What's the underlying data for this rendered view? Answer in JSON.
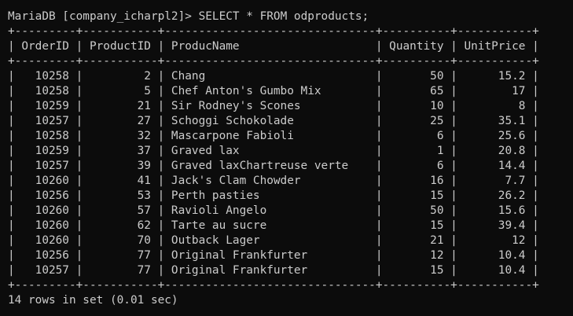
{
  "prompt": "MariaDB [company_icharpl2]>",
  "command": "SELECT * FROM odproducts;",
  "table": {
    "border": "+---------+-----------+-------------------------------+----------+-----------+",
    "header": "| OrderID | ProductID | ProducName                    | Quantity | UnitPrice |",
    "rows": [
      "|   10258 |         2 | Chang                         |       50 |      15.2 |",
      "|   10258 |         5 | Chef Anton's Gumbo Mix        |       65 |        17 |",
      "|   10259 |        21 | Sir Rodney's Scones           |       10 |         8 |",
      "|   10257 |        27 | Schoggi Schokolade            |       25 |      35.1 |",
      "|   10258 |        32 | Mascarpone Fabioli            |        6 |      25.6 |",
      "|   10259 |        37 | Graved lax                    |        1 |      20.8 |",
      "|   10257 |        39 | Graved laxChartreuse verte    |        6 |      14.4 |",
      "|   10260 |        41 | Jack's Clam Chowder           |       16 |       7.7 |",
      "|   10256 |        53 | Perth pasties                 |       15 |      26.2 |",
      "|   10260 |        57 | Ravioli Angelo                |       50 |      15.6 |",
      "|   10260 |        62 | Tarte au sucre                |       15 |      39.4 |",
      "|   10260 |        70 | Outback Lager                 |       21 |        12 |",
      "|   10256 |        77 | Original Frankfurter          |       12 |      10.4 |",
      "|   10257 |        77 | Original Frankfurter          |       15 |      10.4 |"
    ]
  },
  "result": "14 rows in set (0.01 sec)",
  "colors": {
    "background": "#0c0c0c",
    "text": "#cccccc"
  }
}
